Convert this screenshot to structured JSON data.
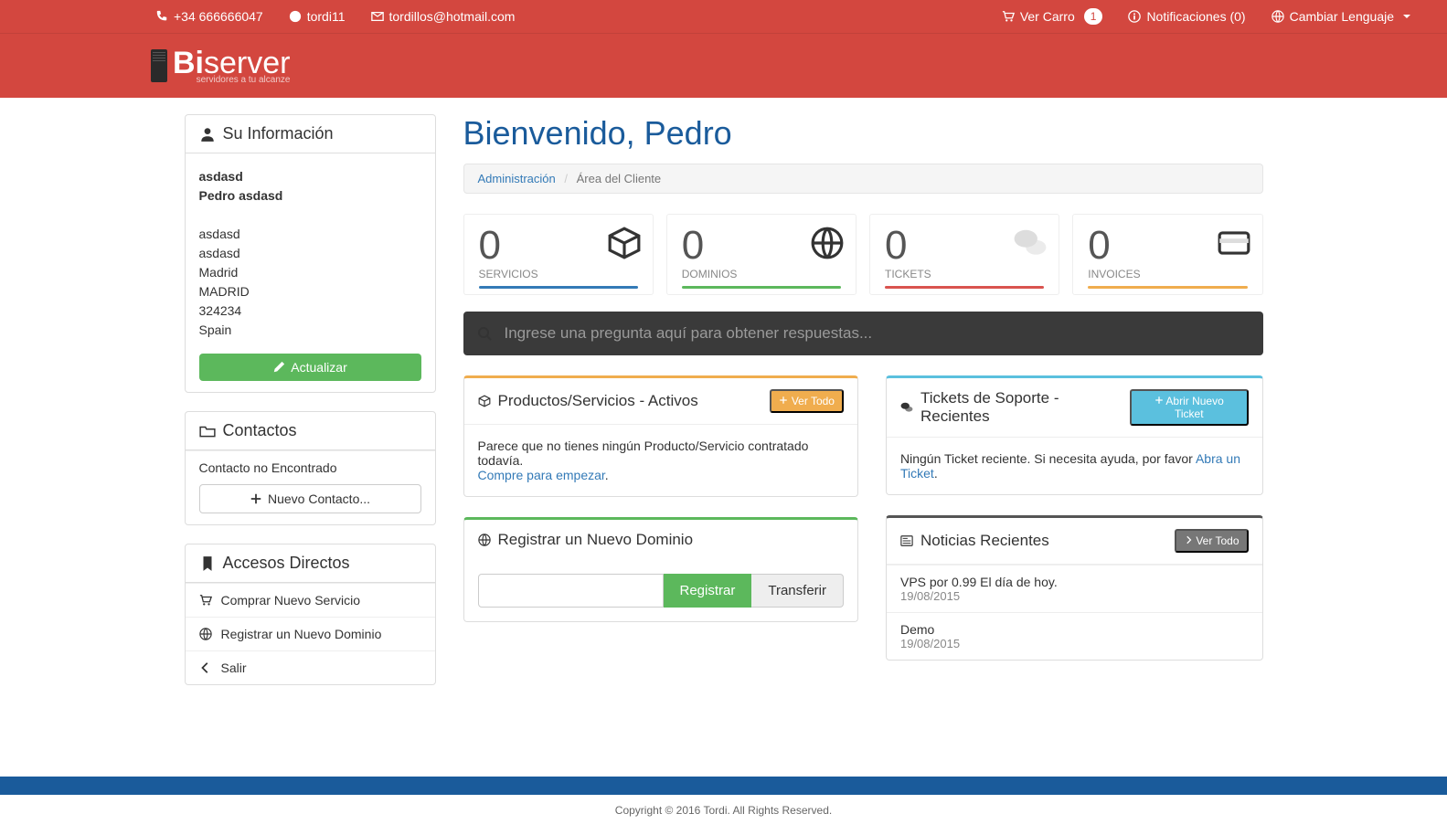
{
  "topbar": {
    "phone": "+34 666666047",
    "skype": "tordi11",
    "email": "tordillos@hotmail.com",
    "cart_label": "Ver Carro",
    "cart_count": "1",
    "notifications_label": "Notificaciones (0)",
    "language_label": "Cambiar Lenguaje"
  },
  "brand": {
    "bold": "Bi",
    "light": "server",
    "tagline": "servidores a tu alcanze"
  },
  "user_info": {
    "title": "Su Información",
    "company": "asdasd",
    "name": "Pedro asdasd",
    "addr1": "asdasd",
    "addr2": "asdasd",
    "city": "Madrid",
    "state": "MADRID",
    "zip": "324234",
    "country": "Spain",
    "update_btn": "Actualizar"
  },
  "contacts": {
    "title": "Contactos",
    "empty": "Contacto no Encontrado",
    "new_btn": "Nuevo Contacto..."
  },
  "shortcuts": {
    "title": "Accesos Directos",
    "items": [
      "Comprar Nuevo Servicio",
      "Registrar un Nuevo Dominio",
      "Salir"
    ]
  },
  "page": {
    "title": "Bienvenido, Pedro",
    "breadcrumb_home": "Administración",
    "breadcrumb_current": "Área del Cliente"
  },
  "stats": [
    {
      "count": "0",
      "label": "SERVICIOS"
    },
    {
      "count": "0",
      "label": "DOMINIOS"
    },
    {
      "count": "0",
      "label": "TICKETS"
    },
    {
      "count": "0",
      "label": "INVOICES"
    }
  ],
  "search": {
    "placeholder": "Ingrese una pregunta aquí para obtener respuestas..."
  },
  "products_card": {
    "title": "Productos/Servicios - Activos",
    "view_all": "Ver Todo",
    "empty1": "Parece que no tienes ningún Producto/Servicio contratado todavía.",
    "empty_link": "Compre para empezar",
    "period": "."
  },
  "domain_card": {
    "title": "Registrar un Nuevo Dominio",
    "register": "Registrar",
    "transfer": "Transferir"
  },
  "tickets_card": {
    "title": "Tickets de Soporte - Recientes",
    "open_btn": "Abrir Nuevo Ticket",
    "empty_pre": "Ningún Ticket reciente. Si necesita ayuda, por favor ",
    "empty_link": "Abra un Ticket",
    "period": "."
  },
  "news_card": {
    "title": "Noticias Recientes",
    "view_all": "Ver Todo",
    "items": [
      {
        "title": "VPS por 0.99 El día de hoy.",
        "date": "19/08/2015"
      },
      {
        "title": "Demo",
        "date": "19/08/2015"
      }
    ]
  },
  "footer": "Copyright © 2016 Tordi. All Rights Reserved."
}
